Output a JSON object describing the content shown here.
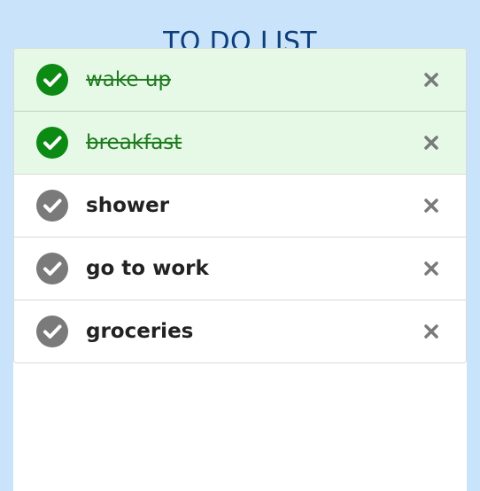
{
  "app": {
    "title": "TO DO LIST"
  },
  "todo": {
    "items": [
      {
        "text": "wake up",
        "completed": true,
        "check_icon": "check-circle-icon",
        "delete_icon": "close-icon"
      },
      {
        "text": "breakfast",
        "completed": true,
        "check_icon": "check-circle-icon",
        "delete_icon": "close-icon"
      },
      {
        "text": "shower",
        "completed": false,
        "check_icon": "check-circle-icon",
        "delete_icon": "close-icon"
      },
      {
        "text": "go to work",
        "completed": false,
        "check_icon": "check-circle-icon",
        "delete_icon": "close-icon"
      },
      {
        "text": "groceries",
        "completed": false,
        "check_icon": "check-circle-icon",
        "delete_icon": "close-icon"
      }
    ]
  },
  "colors": {
    "background": "#c9e3fb",
    "title": "#0d3f7a",
    "completed_row": "#e6f9e6",
    "completed_check": "#0c8a14",
    "completed_text": "#1e7a1e",
    "pending_check": "#7a7a7a",
    "pending_text": "#222222",
    "delete_icon": "#7a7a7a"
  }
}
